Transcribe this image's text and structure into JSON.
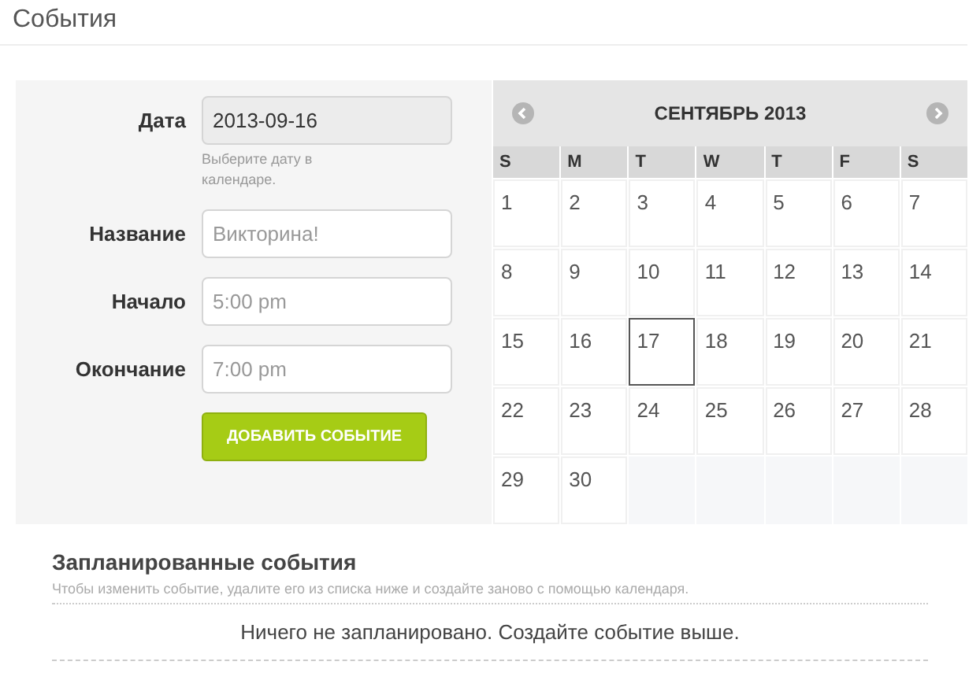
{
  "page_title": "События",
  "form": {
    "fields": [
      {
        "label": "Дата",
        "value": "2013-09-16",
        "readonly": true,
        "help": "Выберите дату в календаре."
      },
      {
        "label": "Название",
        "placeholder": "Викторина!",
        "readonly": false
      },
      {
        "label": "Начало",
        "placeholder": "5:00 pm",
        "readonly": false
      },
      {
        "label": "Окончание",
        "placeholder": "7:00 pm",
        "readonly": false
      }
    ],
    "submit": "ДОБАВИТЬ СОБЫТИЕ"
  },
  "calendar": {
    "title": "СЕНТЯБРЬ 2013",
    "weekdays": [
      "S",
      "M",
      "T",
      "W",
      "T",
      "F",
      "S"
    ],
    "days": [
      {
        "day": "1",
        "selected": false
      },
      {
        "day": "2",
        "selected": false
      },
      {
        "day": "3",
        "selected": false
      },
      {
        "day": "4",
        "selected": false
      },
      {
        "day": "5",
        "selected": false
      },
      {
        "day": "6",
        "selected": false
      },
      {
        "day": "7",
        "selected": false
      },
      {
        "day": "8",
        "selected": false
      },
      {
        "day": "9",
        "selected": false
      },
      {
        "day": "10",
        "selected": false
      },
      {
        "day": "11",
        "selected": false
      },
      {
        "day": "12",
        "selected": false
      },
      {
        "day": "13",
        "selected": false
      },
      {
        "day": "14",
        "selected": false
      },
      {
        "day": "15",
        "selected": false
      },
      {
        "day": "16",
        "selected": false
      },
      {
        "day": "17",
        "selected": true
      },
      {
        "day": "18",
        "selected": false
      },
      {
        "day": "19",
        "selected": false
      },
      {
        "day": "20",
        "selected": false
      },
      {
        "day": "21",
        "selected": false
      },
      {
        "day": "22",
        "selected": false
      },
      {
        "day": "23",
        "selected": false
      },
      {
        "day": "24",
        "selected": false
      },
      {
        "day": "25",
        "selected": false
      },
      {
        "day": "26",
        "selected": false
      },
      {
        "day": "27",
        "selected": false
      },
      {
        "day": "28",
        "selected": false
      },
      {
        "day": "29",
        "selected": false
      },
      {
        "day": "30",
        "selected": false
      }
    ]
  },
  "scheduled": {
    "title": "Запланированные события",
    "hint": "Чтобы изменить событие, удалите его из списка ниже и создайте заново с помощью календаря.",
    "empty_message": "Ничего не запланировано. Создайте событие выше."
  }
}
